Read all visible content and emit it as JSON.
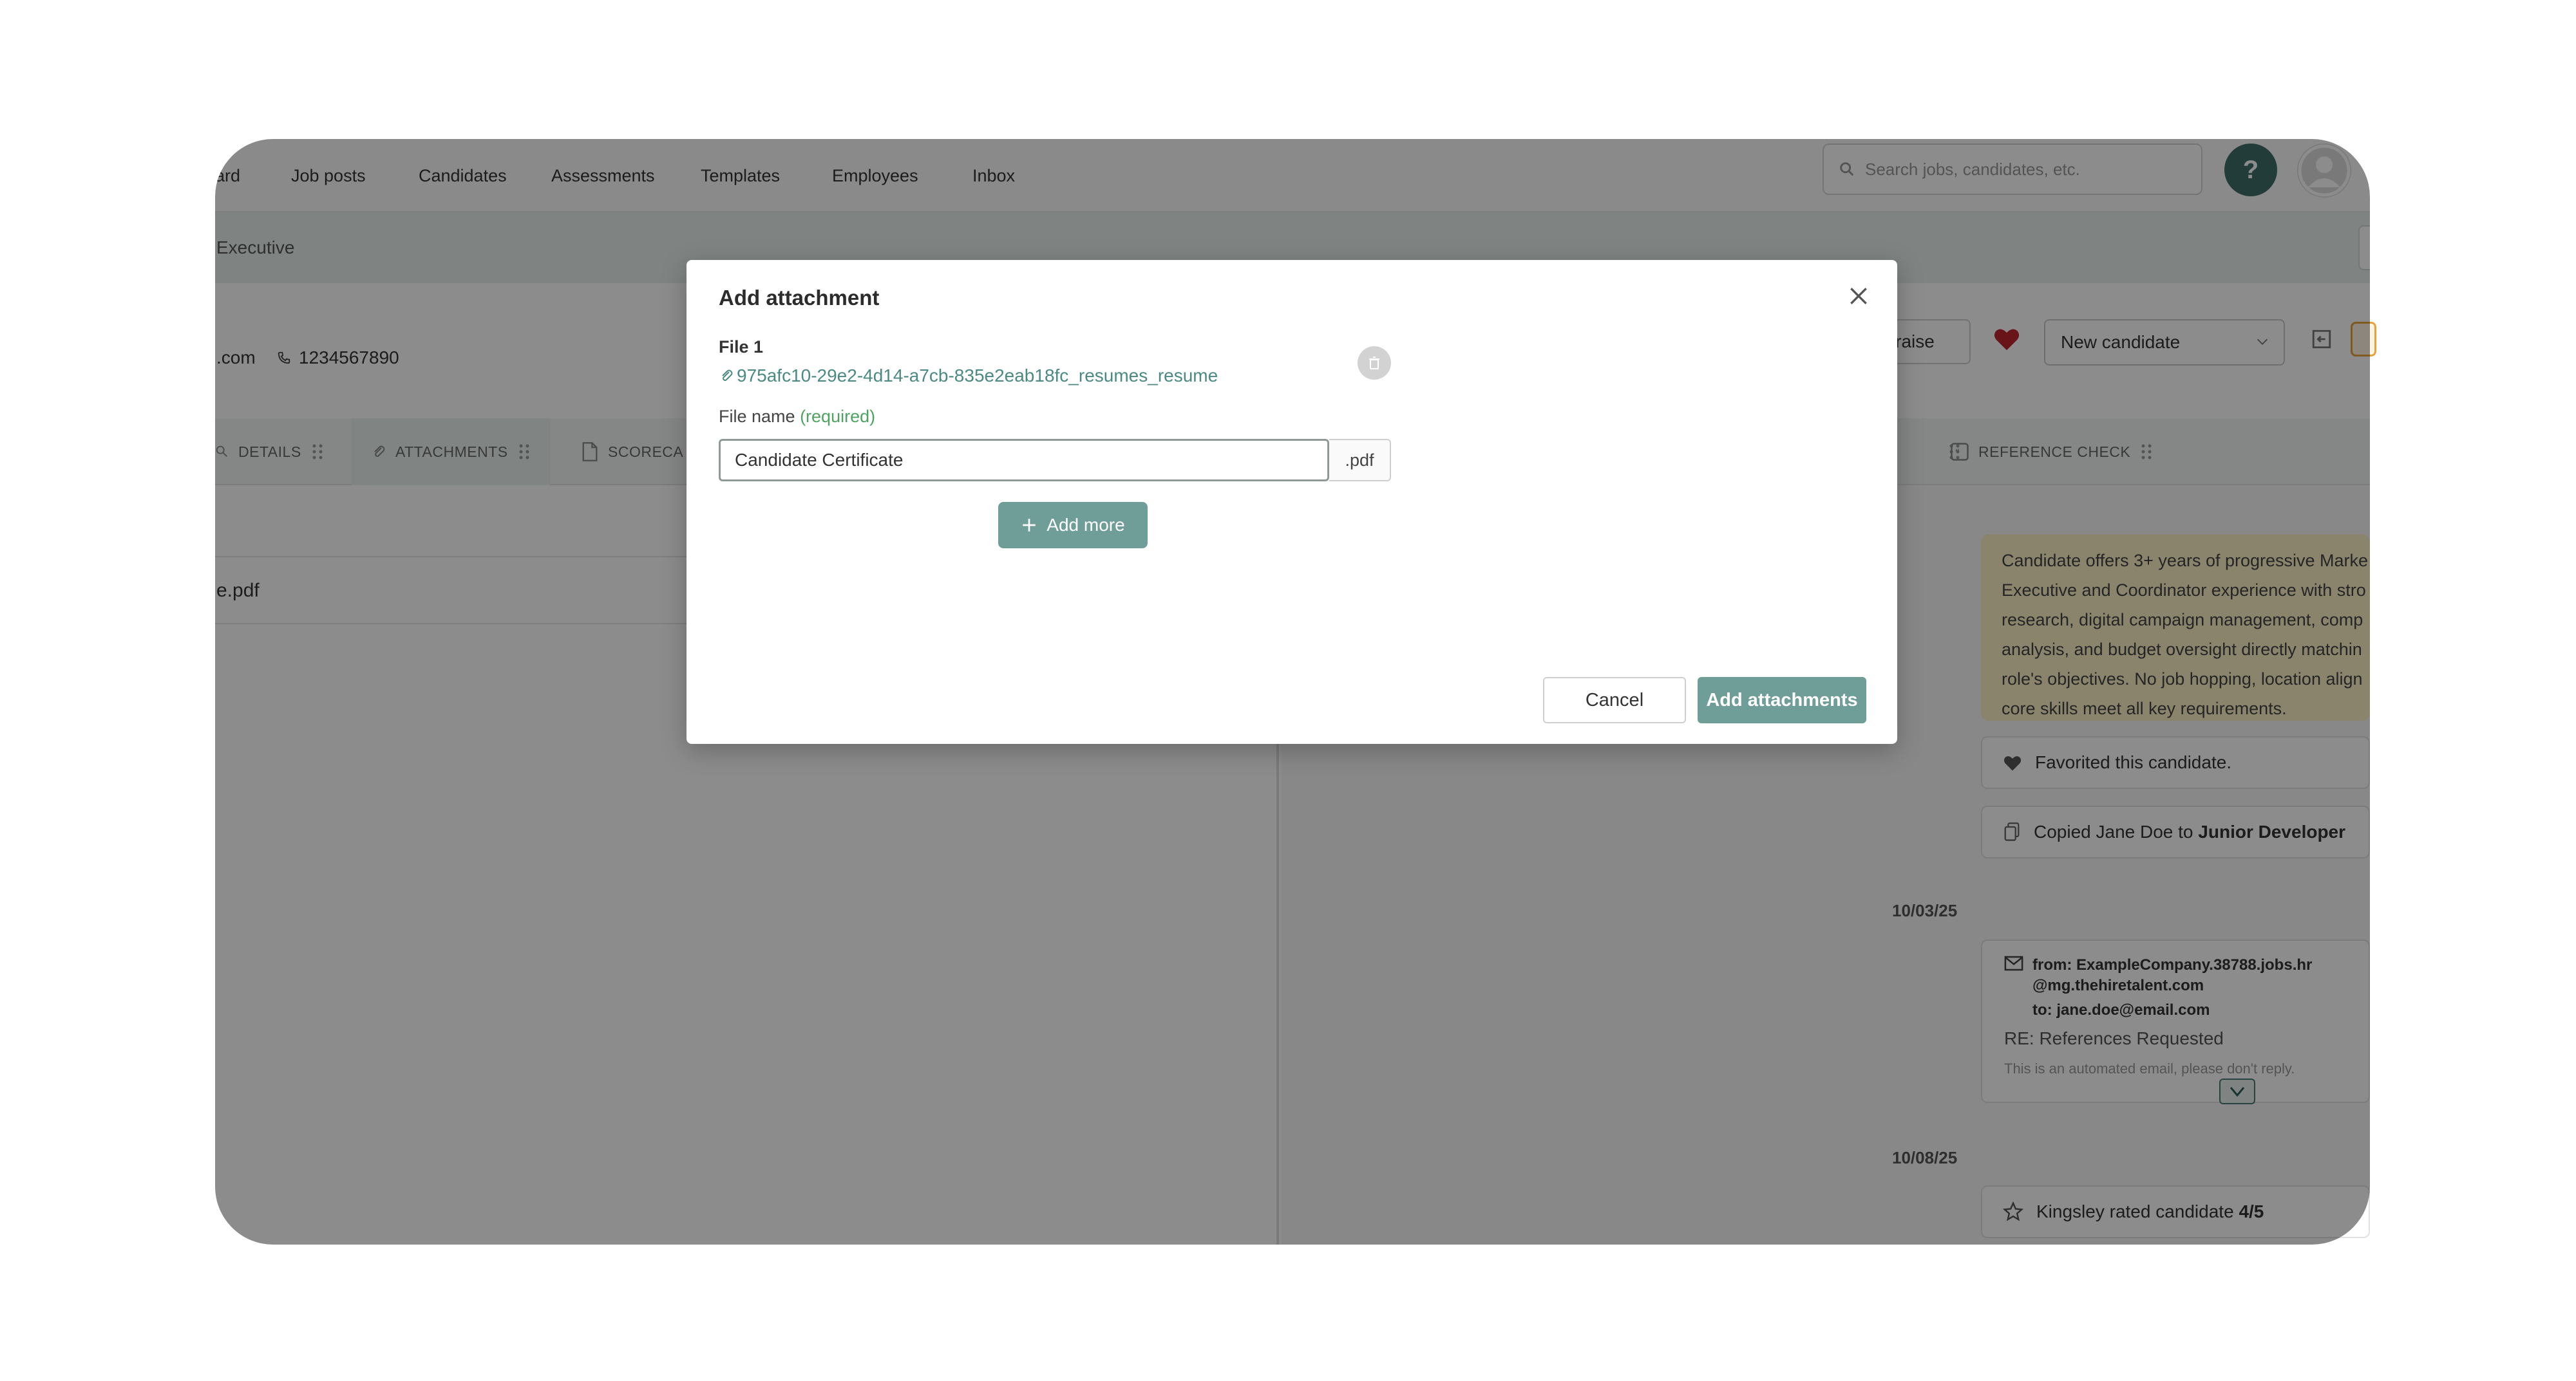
{
  "nav": {
    "items": [
      "ard",
      "Job posts",
      "Candidates",
      "Assessments",
      "Templates",
      "Employees",
      "Inbox"
    ],
    "search_placeholder": "Search jobs, candidates, etc.",
    "help_label": "?"
  },
  "breadcrumb": "Executive",
  "candidate": {
    "email_partial": ".com",
    "phone": "1234567890",
    "appraise_label": "ppraise",
    "status": "New candidate"
  },
  "tabs": {
    "details": "DETAILS",
    "attachments": "ATTACHMENTS",
    "scorecard": "SCORECA",
    "reference_check": "REFERENCE CHECK"
  },
  "left": {
    "file_row": "e.pdf"
  },
  "right": {
    "summary_lines": [
      "Candidate offers 3+ years of progressive Marke",
      "Executive and Coordinator experience with stro",
      "research, digital campaign management, comp",
      "analysis, and budget oversight directly matchin",
      "role's objectives. No job hopping, location align",
      "core skills meet all key requirements."
    ],
    "favorited": "Favorited this candidate.",
    "copied_prefix": "Copied Jane Doe to",
    "copied_target": "Junior Developer",
    "date1": "10/03/25",
    "email_from": "from: ExampleCompany.38788.jobs.hr",
    "email_from2": "@mg.thehiretalent.com",
    "email_to": "to: jane.doe@email.com",
    "email_subject": "RE: References Requested",
    "email_snippet": "This is an automated email, please don't reply.",
    "date2": "10/08/25",
    "rated_prefix": "Kingsley rated candidate",
    "rating": "4/5"
  },
  "modal": {
    "title": "Add attachment",
    "file_label": "File 1",
    "file_name_link": "975afc10-29e2-4d14-a7cb-835e2eab18fc_resumes_resume",
    "file_name_label": "File name",
    "required": "(required)",
    "file_name_value": "Candidate Certificate",
    "extension": ".pdf",
    "add_more": "Add more",
    "cancel": "Cancel",
    "submit": "Add attachments"
  },
  "colors": {
    "accent": "#6f9d98",
    "link": "#4b8a83",
    "required": "#4fa361",
    "heart": "#c0262d"
  }
}
